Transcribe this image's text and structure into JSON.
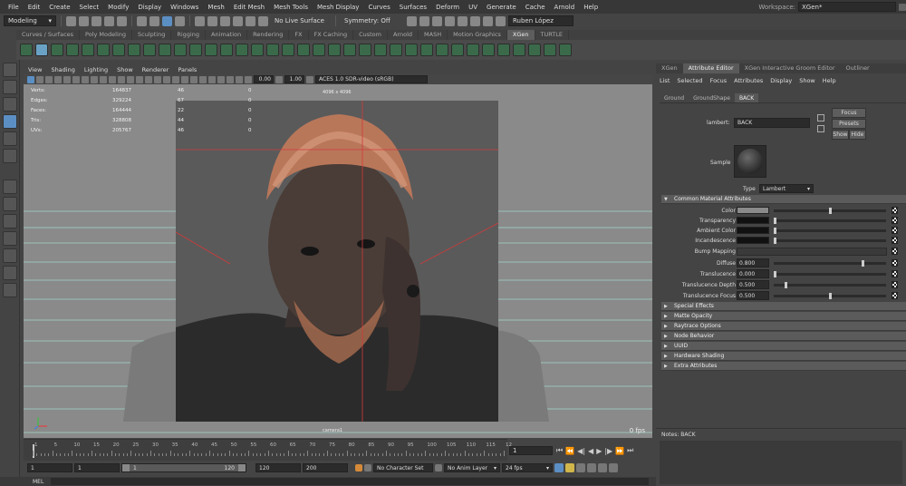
{
  "menubar": {
    "items": [
      "File",
      "Edit",
      "Create",
      "Select",
      "Modify",
      "Display",
      "Windows",
      "Mesh",
      "Edit Mesh",
      "Mesh Tools",
      "Mesh Display",
      "Curves",
      "Surfaces",
      "Deform",
      "UV",
      "Generate",
      "Cache",
      "Arnold",
      "Help"
    ],
    "workspace_label": "Workspace:",
    "workspace_value": "XGen*"
  },
  "statusline": {
    "menuset": "Modeling",
    "live_surface": "No Live Surface",
    "symmetry": "Symmetry: Off",
    "user": "Ruben López"
  },
  "shelf": {
    "tabs": [
      "Curves / Surfaces",
      "Poly Modeling",
      "Sculpting",
      "Rigging",
      "Animation",
      "Rendering",
      "FX",
      "FX Caching",
      "Custom",
      "Arnold",
      "MASH",
      "Motion Graphics",
      "XGen",
      "TURTLE"
    ],
    "active_tab": "XGen"
  },
  "viewport": {
    "menu": [
      "View",
      "Shading",
      "Lighting",
      "Show",
      "Renderer",
      "Panels"
    ],
    "exposure": "0.00",
    "gamma": "1.00",
    "color_space": "ACES 1.0 SDR-video (sRGB)",
    "resolution_label": "4096 x 4096",
    "camera_label": "camera1",
    "fps_label": "0 fps",
    "hud": [
      {
        "label": "Verts:",
        "v1": "164837",
        "v2": "46",
        "v3": "0"
      },
      {
        "label": "Edges:",
        "v1": "329224",
        "v2": "67",
        "v3": "0"
      },
      {
        "label": "Faces:",
        "v1": "164444",
        "v2": "22",
        "v3": "0"
      },
      {
        "label": "Tris:",
        "v1": "328808",
        "v2": "44",
        "v3": "0"
      },
      {
        "label": "UVs:",
        "v1": "205767",
        "v2": "46",
        "v3": "0"
      }
    ]
  },
  "timeline": {
    "ticks": [
      "1",
      "5",
      "10",
      "15",
      "20",
      "25",
      "30",
      "35",
      "40",
      "45",
      "50",
      "55",
      "60",
      "65",
      "70",
      "75",
      "80",
      "85",
      "90",
      "95",
      "100",
      "105",
      "110",
      "115",
      "12"
    ],
    "current_frame": "1"
  },
  "range": {
    "start": "1",
    "playback_start": "1",
    "range_inner_start": "1",
    "range_inner_end": "120",
    "playback_end": "120",
    "end": "200",
    "character_set": "No Character Set",
    "anim_layer": "No Anim Layer",
    "fps": "24 fps"
  },
  "cmdline": {
    "label": "MEL"
  },
  "right_panel": {
    "tabs": [
      "XGen",
      "Attribute Editor",
      "XGen Interactive Groom Editor",
      "Outliner"
    ],
    "active_tab": "Attribute Editor",
    "menu": [
      "List",
      "Selected",
      "Focus",
      "Attributes",
      "Display",
      "Show",
      "Help"
    ],
    "node_tabs": [
      "Ground",
      "GroundShape",
      "BACK"
    ],
    "active_node_tab": "BACK",
    "lambert_label": "lambert:",
    "lambert_name": "BACK",
    "focus_btn": "Focus",
    "presets_btn": "Presets",
    "show_btn": "Show",
    "hide_btn": "Hide",
    "sample_label": "Sample",
    "type_label": "Type",
    "type_value": "Lambert",
    "common_section": "Common Material Attributes",
    "attrs": {
      "color": {
        "label": "Color",
        "swatch": "#8a8a8a",
        "slider": 0.5
      },
      "transparency": {
        "label": "Transparency",
        "swatch": "#111111",
        "slider": 0.0
      },
      "ambient": {
        "label": "Ambient Color",
        "swatch": "#111111",
        "slider": 0.0
      },
      "incandescence": {
        "label": "Incandescence",
        "swatch": "#111111",
        "slider": 0.0
      },
      "bump": {
        "label": "Bump Mapping"
      },
      "diffuse": {
        "label": "Diffuse",
        "value": "0.800",
        "slider": 0.8
      },
      "translucence": {
        "label": "Translucence",
        "value": "0.000",
        "slider": 0.0
      },
      "trans_depth": {
        "label": "Translucence Depth",
        "value": "0.500",
        "slider": 0.1
      },
      "trans_focus": {
        "label": "Translucence Focus",
        "value": "0.500",
        "slider": 0.5
      }
    },
    "sections": [
      "Special Effects",
      "Matte Opacity",
      "Raytrace Options",
      "Node Behavior",
      "UUID",
      "Hardware Shading",
      "Extra Attributes"
    ],
    "notes_label": "Notes: BACK"
  }
}
